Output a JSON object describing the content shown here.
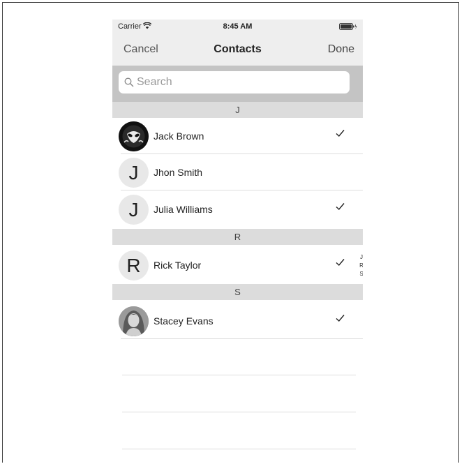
{
  "status_bar": {
    "carrier": "Carrier",
    "time": "8:45 AM"
  },
  "nav": {
    "cancel_label": "Cancel",
    "title": "Contacts",
    "done_label": "Done"
  },
  "search": {
    "placeholder": "Search",
    "value": ""
  },
  "sections": [
    {
      "header": "J",
      "contacts": [
        {
          "name": "Jack Brown",
          "avatar": "photo-alien-icon",
          "checked": true
        },
        {
          "name": "Jhon Smith",
          "avatar_letter": "J",
          "checked": false
        },
        {
          "name": "Julia Williams",
          "avatar_letter": "J",
          "checked": true
        }
      ]
    },
    {
      "header": "R",
      "contacts": [
        {
          "name": "Rick Taylor",
          "avatar_letter": "R",
          "checked": true
        }
      ]
    },
    {
      "header": "S",
      "contacts": [
        {
          "name": "Stacey Evans",
          "avatar": "photo-person",
          "checked": true
        }
      ]
    }
  ],
  "index": [
    "J",
    "R",
    "S"
  ],
  "colors": {
    "nav_bg": "#eeeeee",
    "search_bar_bg": "#c4c4c4",
    "section_bg": "#dcdcdc"
  }
}
